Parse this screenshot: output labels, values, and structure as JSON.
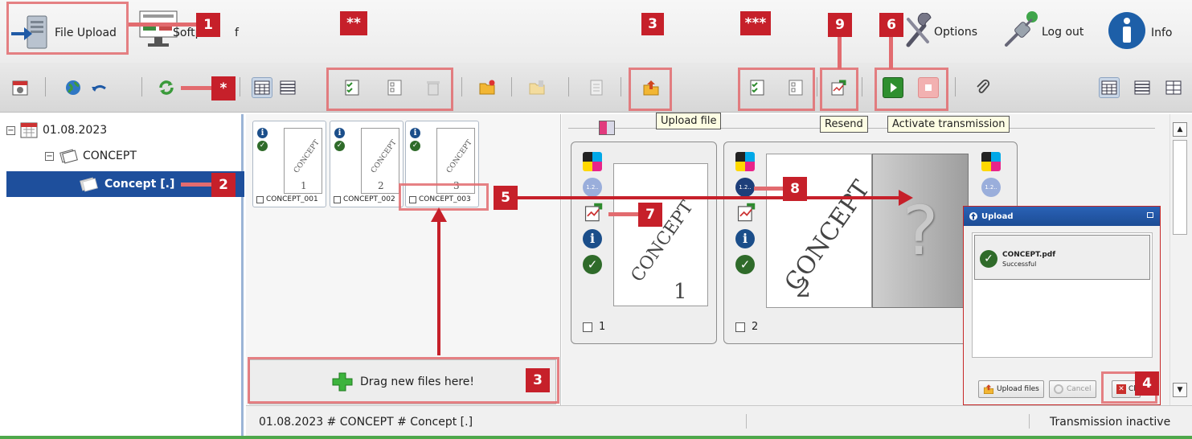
{
  "topbar": {
    "file_upload": "File Upload",
    "software_label": "Softp",
    "software_tail": "f",
    "options": "Options",
    "logout": "Log out",
    "info": "Info"
  },
  "tree": {
    "date": "01.08.2023",
    "folder": "CONCEPT",
    "selected_item": "Concept [.]"
  },
  "thumbnails": [
    {
      "page": "1",
      "label": "CONCEPT_001",
      "watermark": "CONCEPT"
    },
    {
      "page": "2",
      "label": "CONCEPT_002",
      "watermark": "CONCEPT"
    },
    {
      "page": "3",
      "label": "CONCEPT_003",
      "watermark": "CONCEPT"
    }
  ],
  "dropzone": {
    "label": "Drag new files here!"
  },
  "pages": [
    {
      "number": "1",
      "watermark": "CONCEPT",
      "page_digit": "1",
      "badge": "1.2.."
    },
    {
      "number": "2",
      "watermark": "CONCEPT",
      "page_digit": "2",
      "badge": "1.2..",
      "placeholder": "?",
      "badge_right": "1.2.."
    }
  ],
  "tooltips": {
    "upload_file": "Upload file",
    "resend": "Resend",
    "activate": "Activate transmission"
  },
  "dialog": {
    "title": "Upload",
    "file_name": "CONCEPT.pdf",
    "file_status": "Successful",
    "upload_files": "Upload files",
    "cancel": "Cancel",
    "close": "Cl"
  },
  "status": {
    "path": "01.08.2023 # CONCEPT # Concept [.]",
    "transmission": "Transmission inactive"
  },
  "callouts": {
    "c1": "1",
    "c2": "2",
    "c3a": "3",
    "c3b": "3",
    "c4": "4",
    "c5": "5",
    "c6": "6",
    "c7": "7",
    "c8": "8",
    "c9": "9",
    "star1": "*",
    "star2": "**",
    "star3": "***"
  },
  "colors": {
    "accent_red": "#c6202a",
    "highlight": "#e26b6f",
    "selection_blue": "#1e4f9c",
    "status_green": "#4ea84b"
  }
}
